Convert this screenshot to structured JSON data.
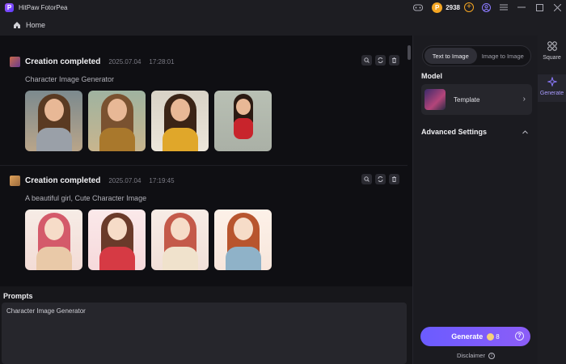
{
  "app": {
    "title": "HitPaw FotorPea",
    "logo_letter": "P"
  },
  "titlebar": {
    "coin_symbol": "P",
    "coin_count": "2938",
    "add_symbol": "+"
  },
  "nav": {
    "home_label": "Home"
  },
  "results": [
    {
      "title": "Creation completed",
      "date": "2025.07.04",
      "time": "17:28:01",
      "prompt": "Character Image Generator",
      "images": [
        "woman-grey-top",
        "woman-mustard-jacket",
        "woman-yellow-cardigan",
        "cartoon-girl-red-jacket"
      ]
    },
    {
      "title": "Creation completed",
      "date": "2025.07.04",
      "time": "17:19:45",
      "prompt": "A beautiful girl, Cute Character Image",
      "images": [
        "anime-girl-pink-1",
        "anime-girl-red-bow",
        "anime-girl-cat-ears",
        "anime-girl-overalls"
      ]
    }
  ],
  "prompts": {
    "title": "Prompts",
    "value": "Character Image Generator"
  },
  "panel": {
    "tabs": [
      "Text to Image",
      "Image to Image"
    ],
    "active_tab": "Text to Image",
    "model_label": "Model",
    "model_name": "Template",
    "advanced_label": "Advanced Settings",
    "generate_label": "Generate",
    "generate_cost": "8",
    "disclaimer": "Disclaimer"
  },
  "sidenav": {
    "square_label": "Square",
    "generate_label": "Generate"
  },
  "colors": {
    "accent": "#6b5cff",
    "coin": "#f5a623"
  }
}
